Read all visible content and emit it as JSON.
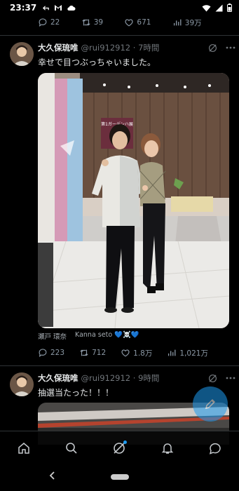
{
  "status_bar": {
    "time": "23:37"
  },
  "prev_tweet_actions": {
    "replies": "22",
    "retweets": "39",
    "likes": "671",
    "views": "39万"
  },
  "tweet1": {
    "name": "大久保琉唯",
    "handle": "@rui912912",
    "time": "7時間",
    "text": "幸せで目つぶっちゃいました。",
    "tags": [
      "瀬戸 環奈",
      "Kanna seto 💙☠️💙"
    ],
    "sign_text": "第1ガーデンハ展",
    "actions": {
      "replies": "223",
      "retweets": "712",
      "likes": "1.8万",
      "views": "1,021万"
    }
  },
  "tweet2": {
    "name": "大久保琉唯",
    "handle": "@rui912912",
    "time": "9時間",
    "text": "抽選当たった！！！"
  },
  "colors": {
    "accent": "#1d9bf0",
    "background": "#000000",
    "muted": "#71767b"
  },
  "icons": {
    "reply": "reply-icon",
    "retweet": "retweet-icon",
    "like": "heart-icon",
    "views": "views-icon",
    "bookmark": "bookmark-icon",
    "share": "share-icon",
    "grok": "grok-icon",
    "more": "more-icon",
    "home": "home-icon",
    "search": "search-icon",
    "notifications": "bell-icon",
    "messages": "messages-icon",
    "compose": "compose-icon"
  }
}
